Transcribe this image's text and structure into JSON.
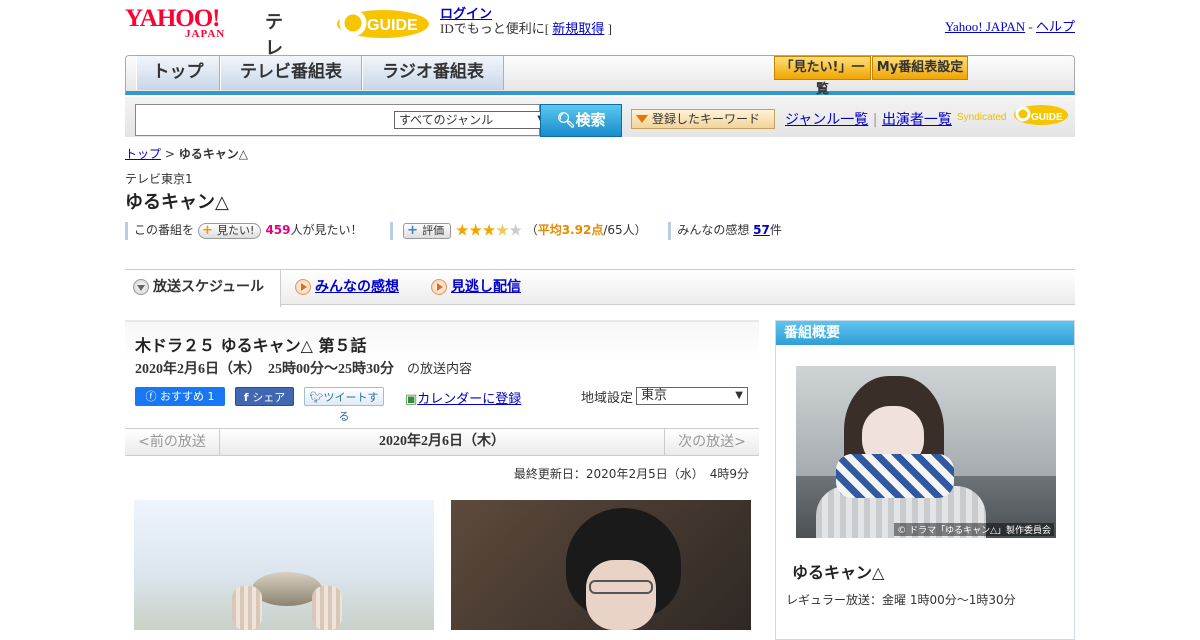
{
  "header": {
    "yahoo": "YAHOO!",
    "japan": "JAPAN",
    "tv": "テレビ",
    "gguide": "GUIDE",
    "login": "ログイン",
    "login_sub_prefix": "IDでもっと便利に[ ",
    "signup": "新規取得",
    "login_sub_suffix": " ]",
    "yj_link": "Yahoo! JAPAN",
    "sep": " - ",
    "help": "ヘルプ"
  },
  "nav": {
    "tabs": [
      "トップ",
      "テレビ番組表",
      "ラジオ番組表"
    ],
    "btn_watchlist": "「見たい!」一覧",
    "btn_mylist": "My番組表設定"
  },
  "search": {
    "genre": "すべてのジャンル",
    "button": "検索",
    "keyword_btn": "登録したキーワード",
    "genre_list": "ジャンル一覧",
    "divider": "|",
    "cast_list": "出演者一覧",
    "syndicated": "Syndicated"
  },
  "breadcrumb": {
    "top": "トップ",
    "sep": " > ",
    "current": "ゆるキャン△"
  },
  "program": {
    "station": "テレビ東京1",
    "title": "ゆるキャン△",
    "want_prefix": "この番組を",
    "want_btn": "見たい!",
    "want_count": "459",
    "want_suffix": "人が見たい！",
    "rate_btn": "評価",
    "rating": 3.92,
    "rating_text": "平均3.92点",
    "rating_paren_open": "（",
    "rating_votes": "/65人）",
    "review_prefix": "みんなの感想",
    "review_count": "57",
    "review_suffix": "件"
  },
  "section_tabs": [
    "放送スケジュール",
    "みんなの感想",
    "見逃し配信"
  ],
  "episode": {
    "title": "木ドラ２５ ゆるキャン△ 第５話",
    "date": "2020年2月6日（木）　25時00分～25時30分",
    "date_suffix": "の放送内容",
    "fb_like": "おすすめ 1",
    "fb_share": "シェア",
    "tweet": "ツイートする",
    "calendar": "カレンダーに登録",
    "region_label": "地域設定",
    "region": "東京",
    "prev": "<前の放送",
    "current": "2020年2月6日（木）",
    "next": "次の放送>",
    "updated": "最終更新日：2020年2月5日（水）　4時9分"
  },
  "sidebar": {
    "heading": "番組概要",
    "img_caption": "© ドラマ「ゆるキャン△」製作委員会",
    "title": "ゆるキャン△",
    "regular": "レギュラー放送：金曜 1時00分～1時30分"
  },
  "colors": {
    "accent": "#3399cc",
    "brand_red": "#ff0033",
    "star": "#f0a600",
    "count": "#e4007f"
  }
}
